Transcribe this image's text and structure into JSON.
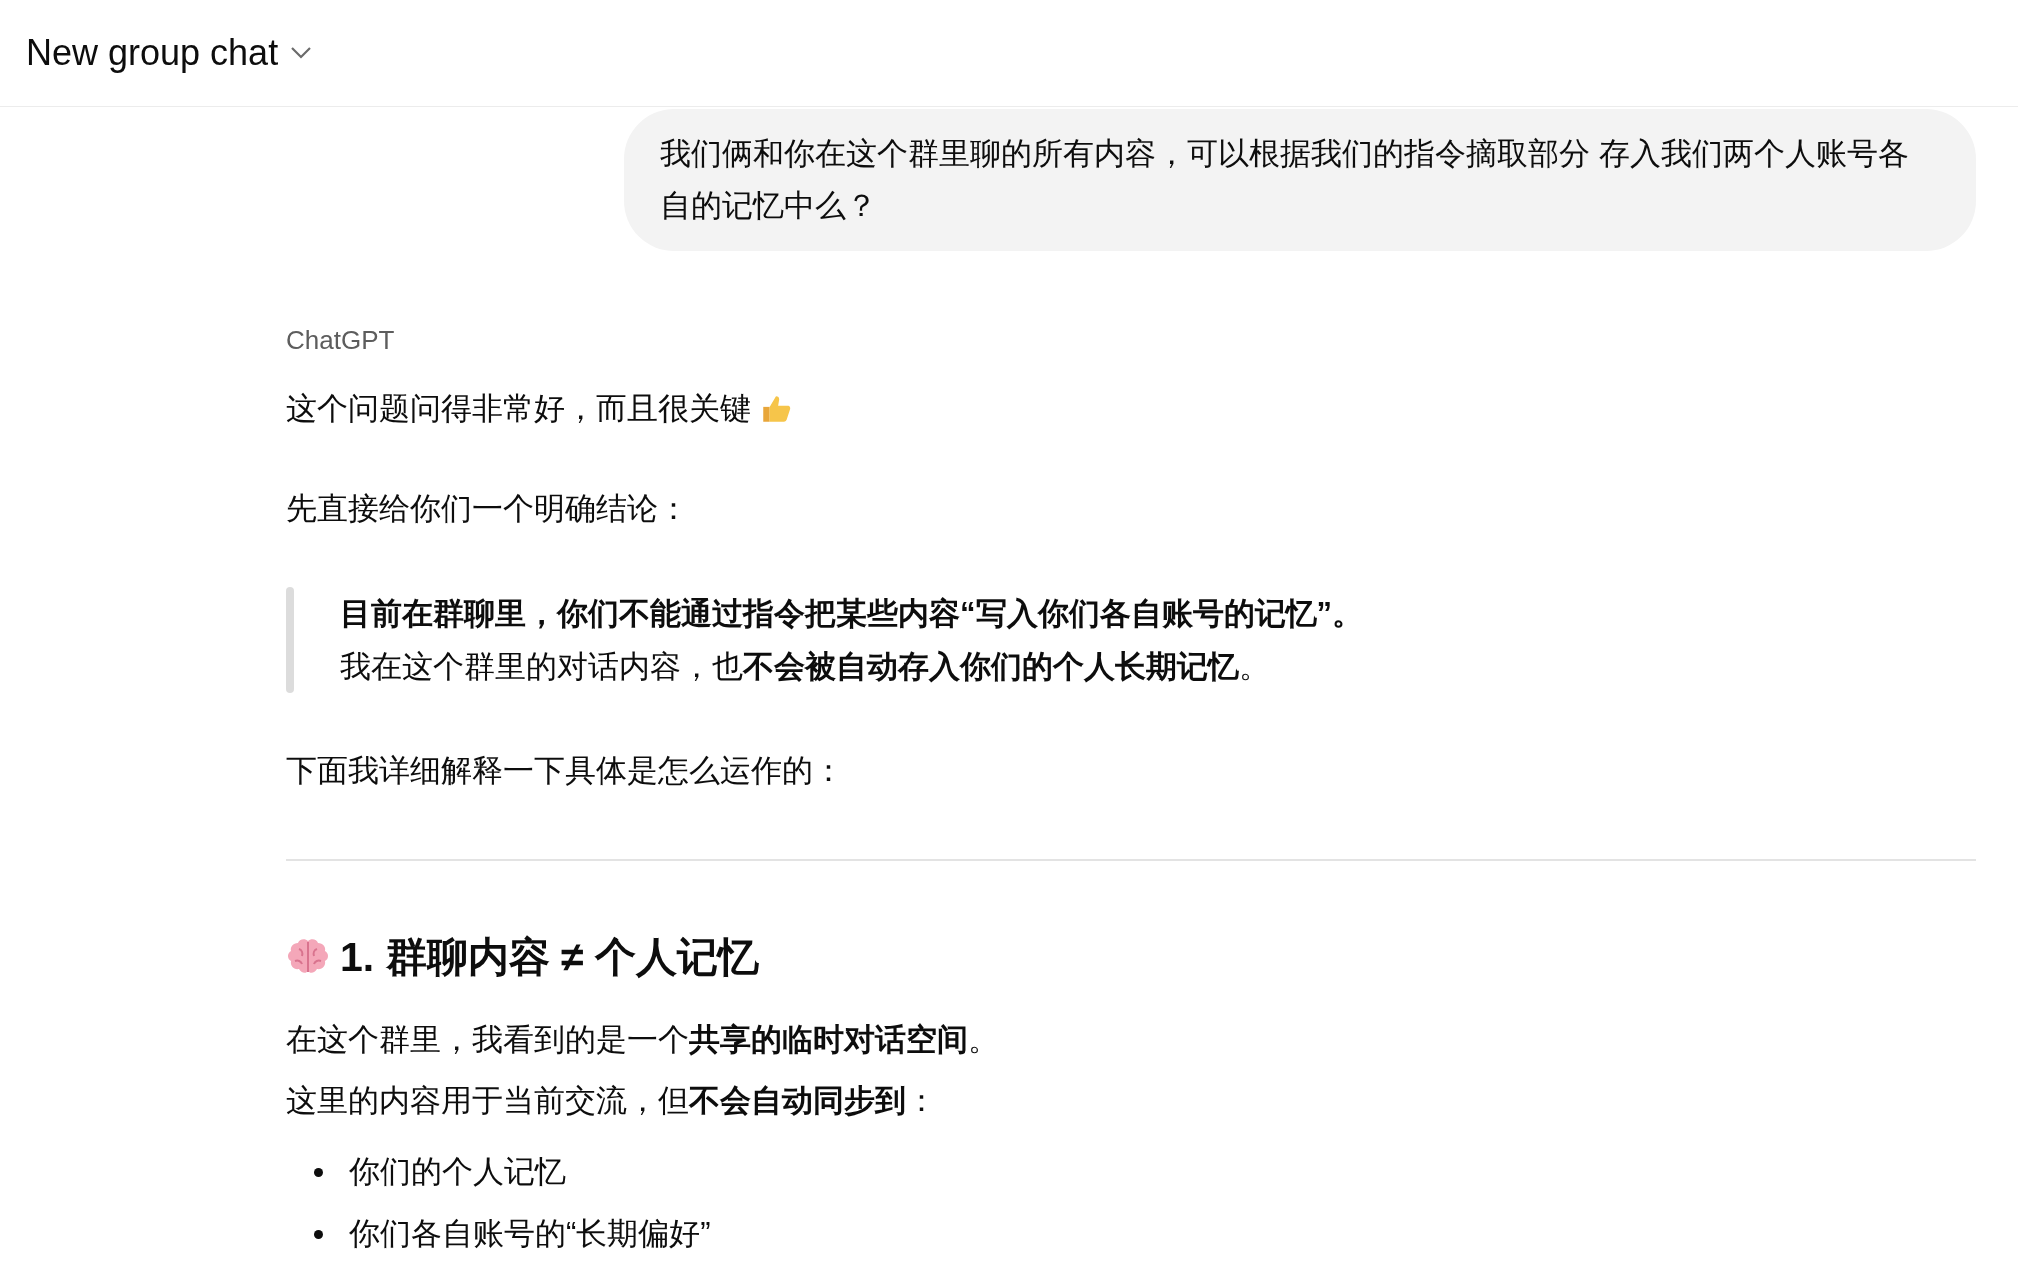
{
  "header": {
    "title": "New group chat"
  },
  "user_message": {
    "text": "我们俩和你在这个群里聊的所有内容，可以根据我们的指令摘取部分 存入我们两个人账号各自的记忆中么？"
  },
  "assistant": {
    "author": "ChatGPT",
    "blocks": [
      {
        "kind": "paragraph",
        "text": "这个问题问得非常好，而且很关键",
        "trailing_icon": true
      },
      {
        "kind": "paragraph",
        "text": "先直接给你们一个明确结论："
      },
      {
        "kind": "quote",
        "lines": [
          "**目前在群聊里，你们不能通过指令把某些内容“写入你们各自账号的记忆”。**",
          "我在这个群里的对话内容，也**不会被自动存入你们的个人长期记忆**。"
        ]
      },
      {
        "kind": "paragraph",
        "text": "下面我详细解释一下具体是怎么运作的："
      },
      {
        "kind": "divider"
      },
      {
        "kind": "heading",
        "text": "1. 群聊内容 ≠ 个人记忆",
        "leading_icon": true
      },
      {
        "kind": "lines",
        "lines": [
          "在这个群里，我看到的是一个**共享的临时对话空间**。",
          "这里的内容用于当前交流，但**不会自动同步到**："
        ]
      },
      {
        "kind": "bullets",
        "items": [
          "你们的个人记忆",
          "你们各自账号的“长期偏好”"
        ]
      }
    ]
  }
}
